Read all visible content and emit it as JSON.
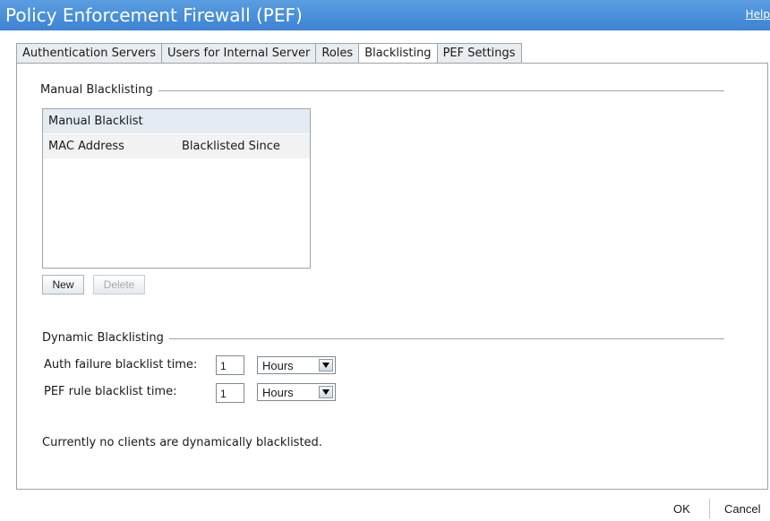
{
  "window": {
    "title": "Policy Enforcement Firewall (PEF)",
    "help_link": "Help"
  },
  "tabs": [
    {
      "label": "Authentication Servers",
      "active": false
    },
    {
      "label": "Users for Internal Server",
      "active": false
    },
    {
      "label": "Roles",
      "active": false
    },
    {
      "label": "Blacklisting",
      "active": true
    },
    {
      "label": "PEF Settings",
      "active": false
    }
  ],
  "manual": {
    "section_title": "Manual Blacklisting",
    "list_title": "Manual Blacklist",
    "columns": [
      "MAC Address",
      "Blacklisted Since"
    ],
    "rows": [],
    "new_button": "New",
    "delete_button": "Delete"
  },
  "dynamic": {
    "section_title": "Dynamic Blacklisting",
    "auth_failure_label": "Auth failure blacklist time:",
    "auth_failure_value": "1",
    "auth_failure_unit": "Hours",
    "pef_rule_label": "PEF rule blacklist time:",
    "pef_rule_value": "1",
    "pef_rule_unit": "Hours"
  },
  "status_text": "Currently no clients are dynamically blacklisted.",
  "footer": {
    "ok": "OK",
    "cancel": "Cancel"
  },
  "colors": {
    "titlebar": "#3c83d3",
    "border": "#9aa4ae"
  }
}
